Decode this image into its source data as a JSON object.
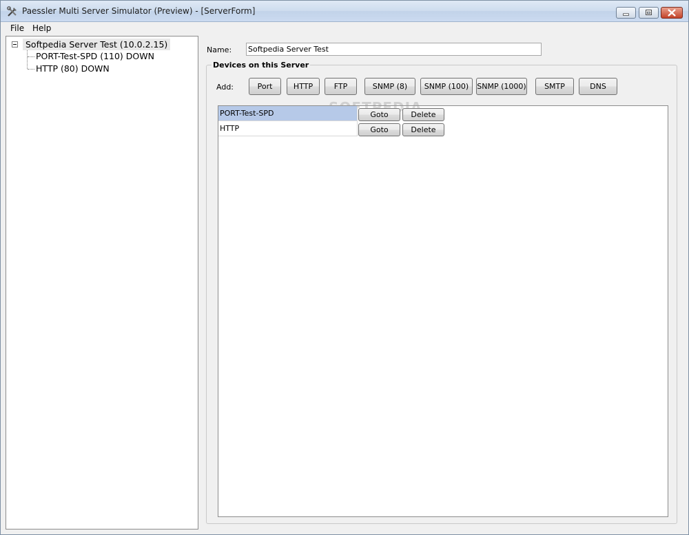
{
  "window": {
    "title": "Paessler Multi Server Simulator (Preview) - [ServerForm]"
  },
  "menu": [
    "File",
    "Help"
  ],
  "tree": {
    "root": "Softpedia Server Test (10.0.2.15)",
    "children": [
      "PORT-Test-SPD (110)  DOWN",
      "HTTP (80)  DOWN"
    ]
  },
  "form": {
    "name_label": "Name:",
    "name_value": "Softpedia Server Test",
    "group_title": "Devices on this Server",
    "add_label": "Add:",
    "add_buttons": [
      "Port",
      "HTTP",
      "FTP",
      "SNMP (8)",
      "SNMP (100)",
      "SNMP (1000)",
      "SMTP",
      "DNS"
    ]
  },
  "devices": [
    {
      "name": "PORT-Test-SPD",
      "goto_label": "Goto",
      "delete_label": "Delete"
    },
    {
      "name": "HTTP",
      "goto_label": "Goto",
      "delete_label": "Delete"
    }
  ],
  "watermark": "SOFTPEDIA"
}
